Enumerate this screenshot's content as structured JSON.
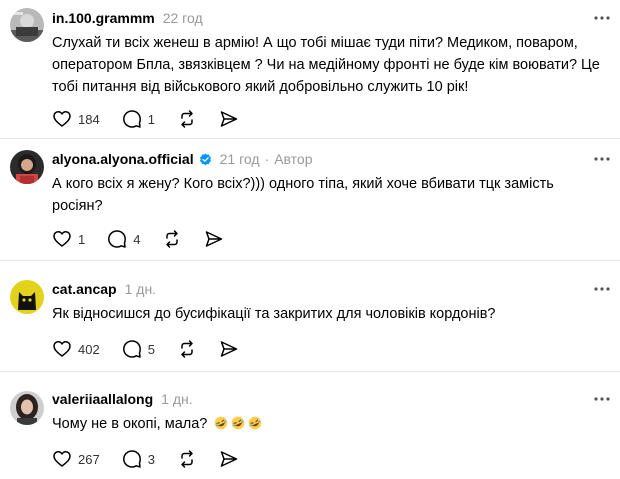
{
  "comments": [
    {
      "username": "in.100.grammm",
      "time": "22 год",
      "text": "Слухай ти всіх женеш в армію! А що тобі мішає туди піти? Медиком, поваром, оператором Бпла, звязківцем ? Чи на медійному фронті не буде кім воювати? Це тобі питання від військового який добровільно служить 10 рік!",
      "likes": "184",
      "replies": "1"
    },
    {
      "username": "alyona.alyona.official",
      "time": "21 год",
      "separator": "·",
      "author_tag": "Автор",
      "text": "А кого всіх я жену? Кого всіх?))) одного тіпа, який хоче вбивати тцк замість росіян?",
      "likes": "1",
      "replies": "4"
    },
    {
      "username": "cat.ancap",
      "time": "1 дн.",
      "text": "Як відносишся до бусифікації та закритих для чоловіків кордонів?",
      "likes": "402",
      "replies": "5"
    },
    {
      "username": "valeriiaallalong",
      "time": "1 дн.",
      "text": "Чому не в окопі, мала?",
      "emojis": [
        "rolling-on-floor-laughing",
        "rolling-on-floor-laughing",
        "rolling-on-floor-laughing"
      ],
      "likes": "267",
      "replies": "3"
    }
  ],
  "icons": {
    "like": "heart-icon",
    "reply": "comment-icon",
    "repost": "repost-icon",
    "share": "send-icon",
    "more": "more-icon",
    "verified": "verified-badge-icon"
  },
  "colors": {
    "verified": "#0095f6",
    "muted": "#999999"
  }
}
